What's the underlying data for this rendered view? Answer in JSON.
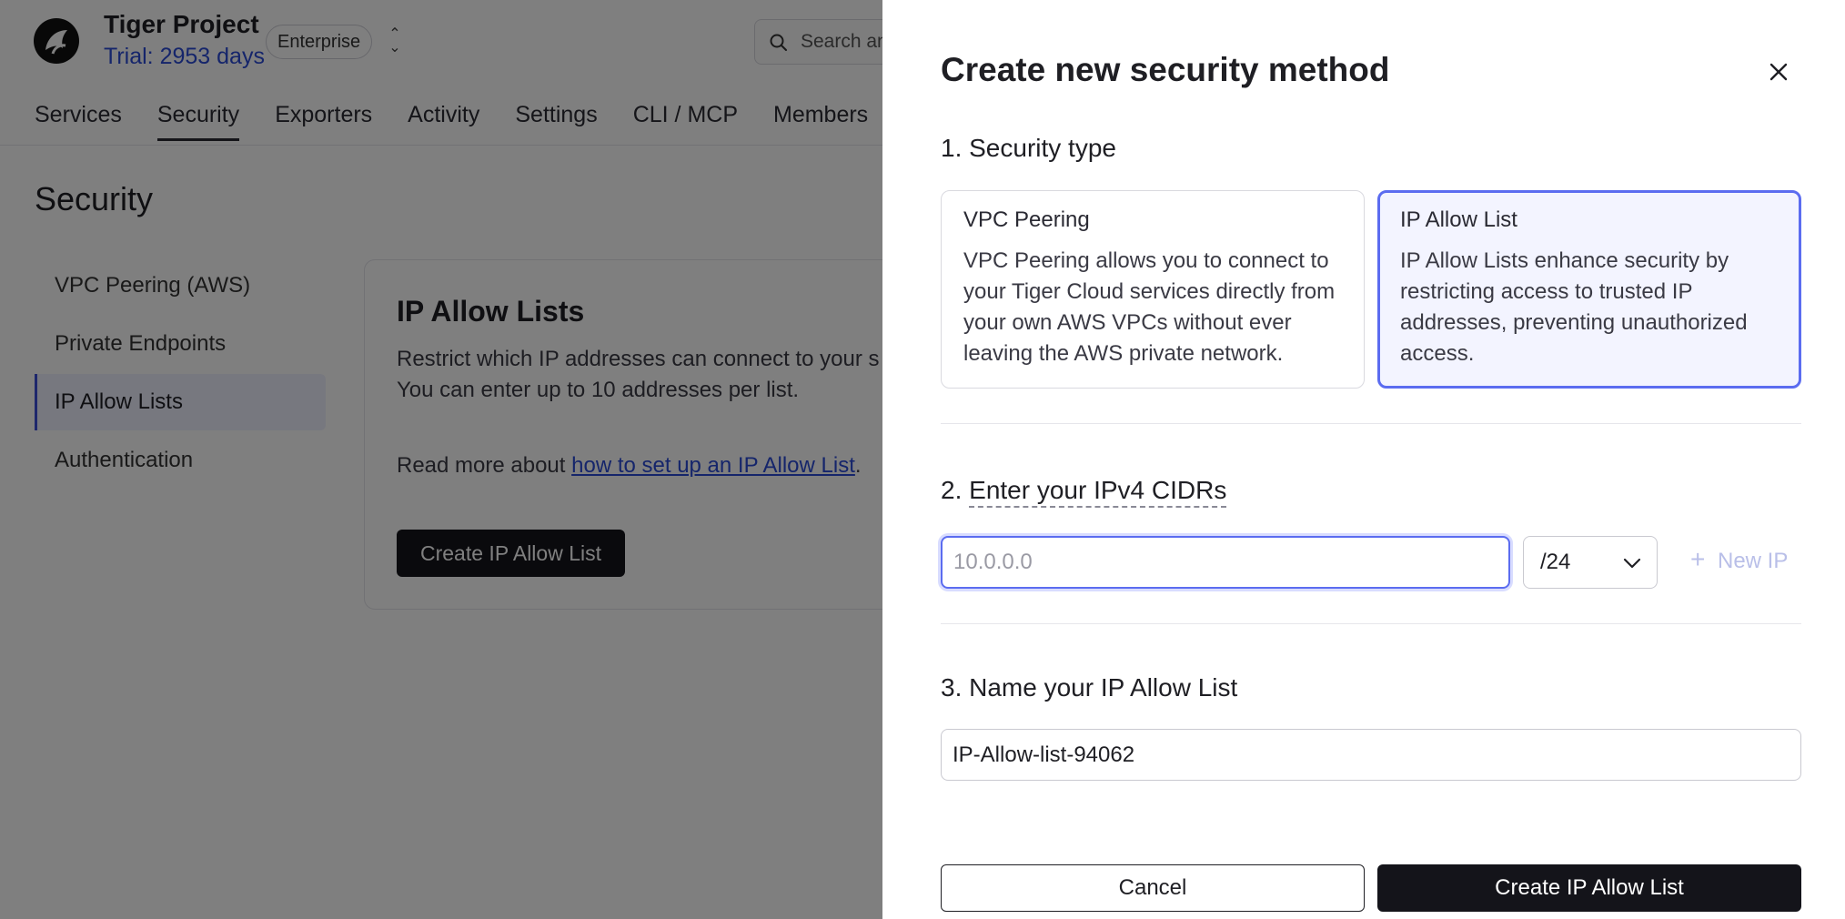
{
  "header": {
    "project_name": "Tiger Project",
    "trial": "Trial: 2953 days",
    "plan_badge": "Enterprise",
    "search_placeholder": "Search an"
  },
  "nav": {
    "items": [
      "Services",
      "Security",
      "Exporters",
      "Activity",
      "Settings",
      "CLI / MCP",
      "Members"
    ],
    "active": "Security"
  },
  "page": {
    "title": "Security"
  },
  "side_menu": {
    "items": [
      "VPC Peering (AWS)",
      "Private Endpoints",
      "IP Allow Lists",
      "Authentication"
    ],
    "active": "IP Allow Lists"
  },
  "card": {
    "title": "IP Allow Lists",
    "desc_line1": "Restrict which IP addresses can connect to your s",
    "desc_line2": "You can enter up to 10 addresses per list.",
    "read_more_prefix": "Read more about ",
    "read_more_link": "how to set up an IP Allow List",
    "read_more_suffix": ".",
    "create_button": "Create IP Allow List"
  },
  "drawer": {
    "title": "Create new security method",
    "step1_label": "1. Security type",
    "types": [
      {
        "title": "VPC Peering",
        "description": "VPC Peering allows you to connect to your Tiger Cloud services directly from your own AWS VPCs without ever leaving the AWS private network.",
        "selected": false
      },
      {
        "title": "IP Allow List",
        "description": "IP Allow Lists enhance security by restricting access to trusted IP addresses, preventing unauthorized access.",
        "selected": true
      }
    ],
    "step2_prefix": "2. ",
    "step2_label": "Enter your IPv4 CIDRs",
    "cidr_input": {
      "value": "",
      "placeholder": "10.0.0.0"
    },
    "mask_select": {
      "value": "/24"
    },
    "new_ip_label": "New IP",
    "step3_label": "3. Name your IP Allow List",
    "name_input": {
      "value": "IP-Allow-list-94062"
    },
    "cancel_label": "Cancel",
    "submit_label": "Create IP Allow List"
  },
  "colors": {
    "accent": "#5b6cf0",
    "link": "#2b4bd6",
    "primary_button": "#14141a"
  }
}
